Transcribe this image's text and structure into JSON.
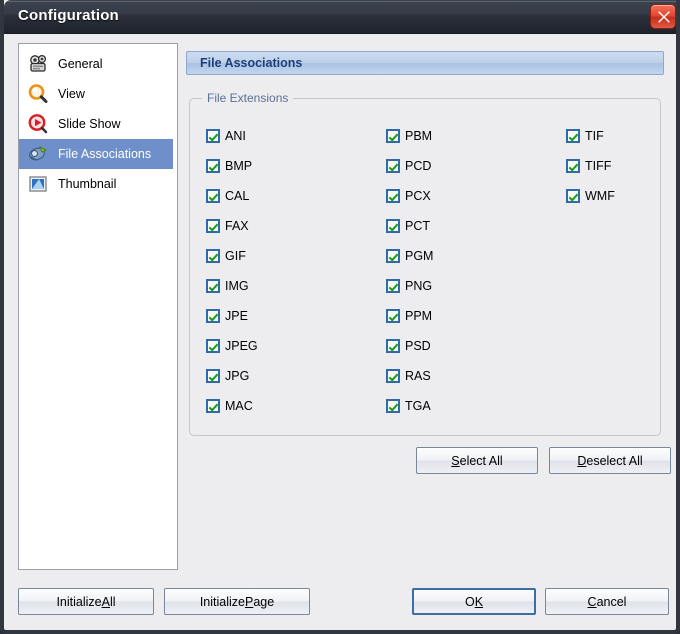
{
  "window": {
    "title": "Configuration",
    "close_icon": "close-x-icon"
  },
  "sidebar": {
    "items": [
      {
        "label": "General",
        "icon": "camera-icon",
        "selected": false
      },
      {
        "label": "View",
        "icon": "magnifier-icon",
        "selected": false
      },
      {
        "label": "Slide Show",
        "icon": "play-circle-icon",
        "selected": false
      },
      {
        "label": "File Associations",
        "icon": "file-link-icon",
        "selected": true
      },
      {
        "label": "Thumbnail",
        "icon": "thumbnail-image-icon",
        "selected": false
      }
    ]
  },
  "panel": {
    "header": "File Associations",
    "groupbox_title": "File Extensions",
    "columns": [
      [
        {
          "label": "ANI",
          "checked": true
        },
        {
          "label": "BMP",
          "checked": true
        },
        {
          "label": "CAL",
          "checked": true
        },
        {
          "label": "FAX",
          "checked": true
        },
        {
          "label": "GIF",
          "checked": true
        },
        {
          "label": "IMG",
          "checked": true
        },
        {
          "label": "JPE",
          "checked": true
        },
        {
          "label": "JPEG",
          "checked": true
        },
        {
          "label": "JPG",
          "checked": true
        },
        {
          "label": "MAC",
          "checked": true
        }
      ],
      [
        {
          "label": "PBM",
          "checked": true
        },
        {
          "label": "PCD",
          "checked": true
        },
        {
          "label": "PCX",
          "checked": true
        },
        {
          "label": "PCT",
          "checked": true
        },
        {
          "label": "PGM",
          "checked": true
        },
        {
          "label": "PNG",
          "checked": true
        },
        {
          "label": "PPM",
          "checked": true
        },
        {
          "label": "PSD",
          "checked": true
        },
        {
          "label": "RAS",
          "checked": true
        },
        {
          "label": "TGA",
          "checked": true
        }
      ],
      [
        {
          "label": "TIF",
          "checked": true
        },
        {
          "label": "TIFF",
          "checked": true
        },
        {
          "label": "WMF",
          "checked": true
        }
      ]
    ],
    "select_all": {
      "pre": "",
      "accel": "S",
      "post": "elect All"
    },
    "deselect_all": {
      "pre": "",
      "accel": "D",
      "post": "eselect All"
    }
  },
  "footer": {
    "initialize_all": {
      "pre": "Initialize ",
      "accel": "A",
      "post": "ll"
    },
    "initialize_page": {
      "pre": "Initialize ",
      "accel": "P",
      "post": "age"
    },
    "ok": {
      "pre": "O",
      "accel": "K",
      "post": ""
    },
    "cancel": {
      "pre": "",
      "accel": "C",
      "post": "ancel"
    }
  },
  "colors": {
    "titlebar": "#2b303a",
    "selection": "#6f8fca",
    "panel_header_text": "#1d3f77",
    "checkbox_border": "#2e6ba8",
    "checkmark": "#1c9a1c",
    "close_button": "#e24a32",
    "dialog_background": "#edecef",
    "default_button_border": "#3b6ea5"
  }
}
